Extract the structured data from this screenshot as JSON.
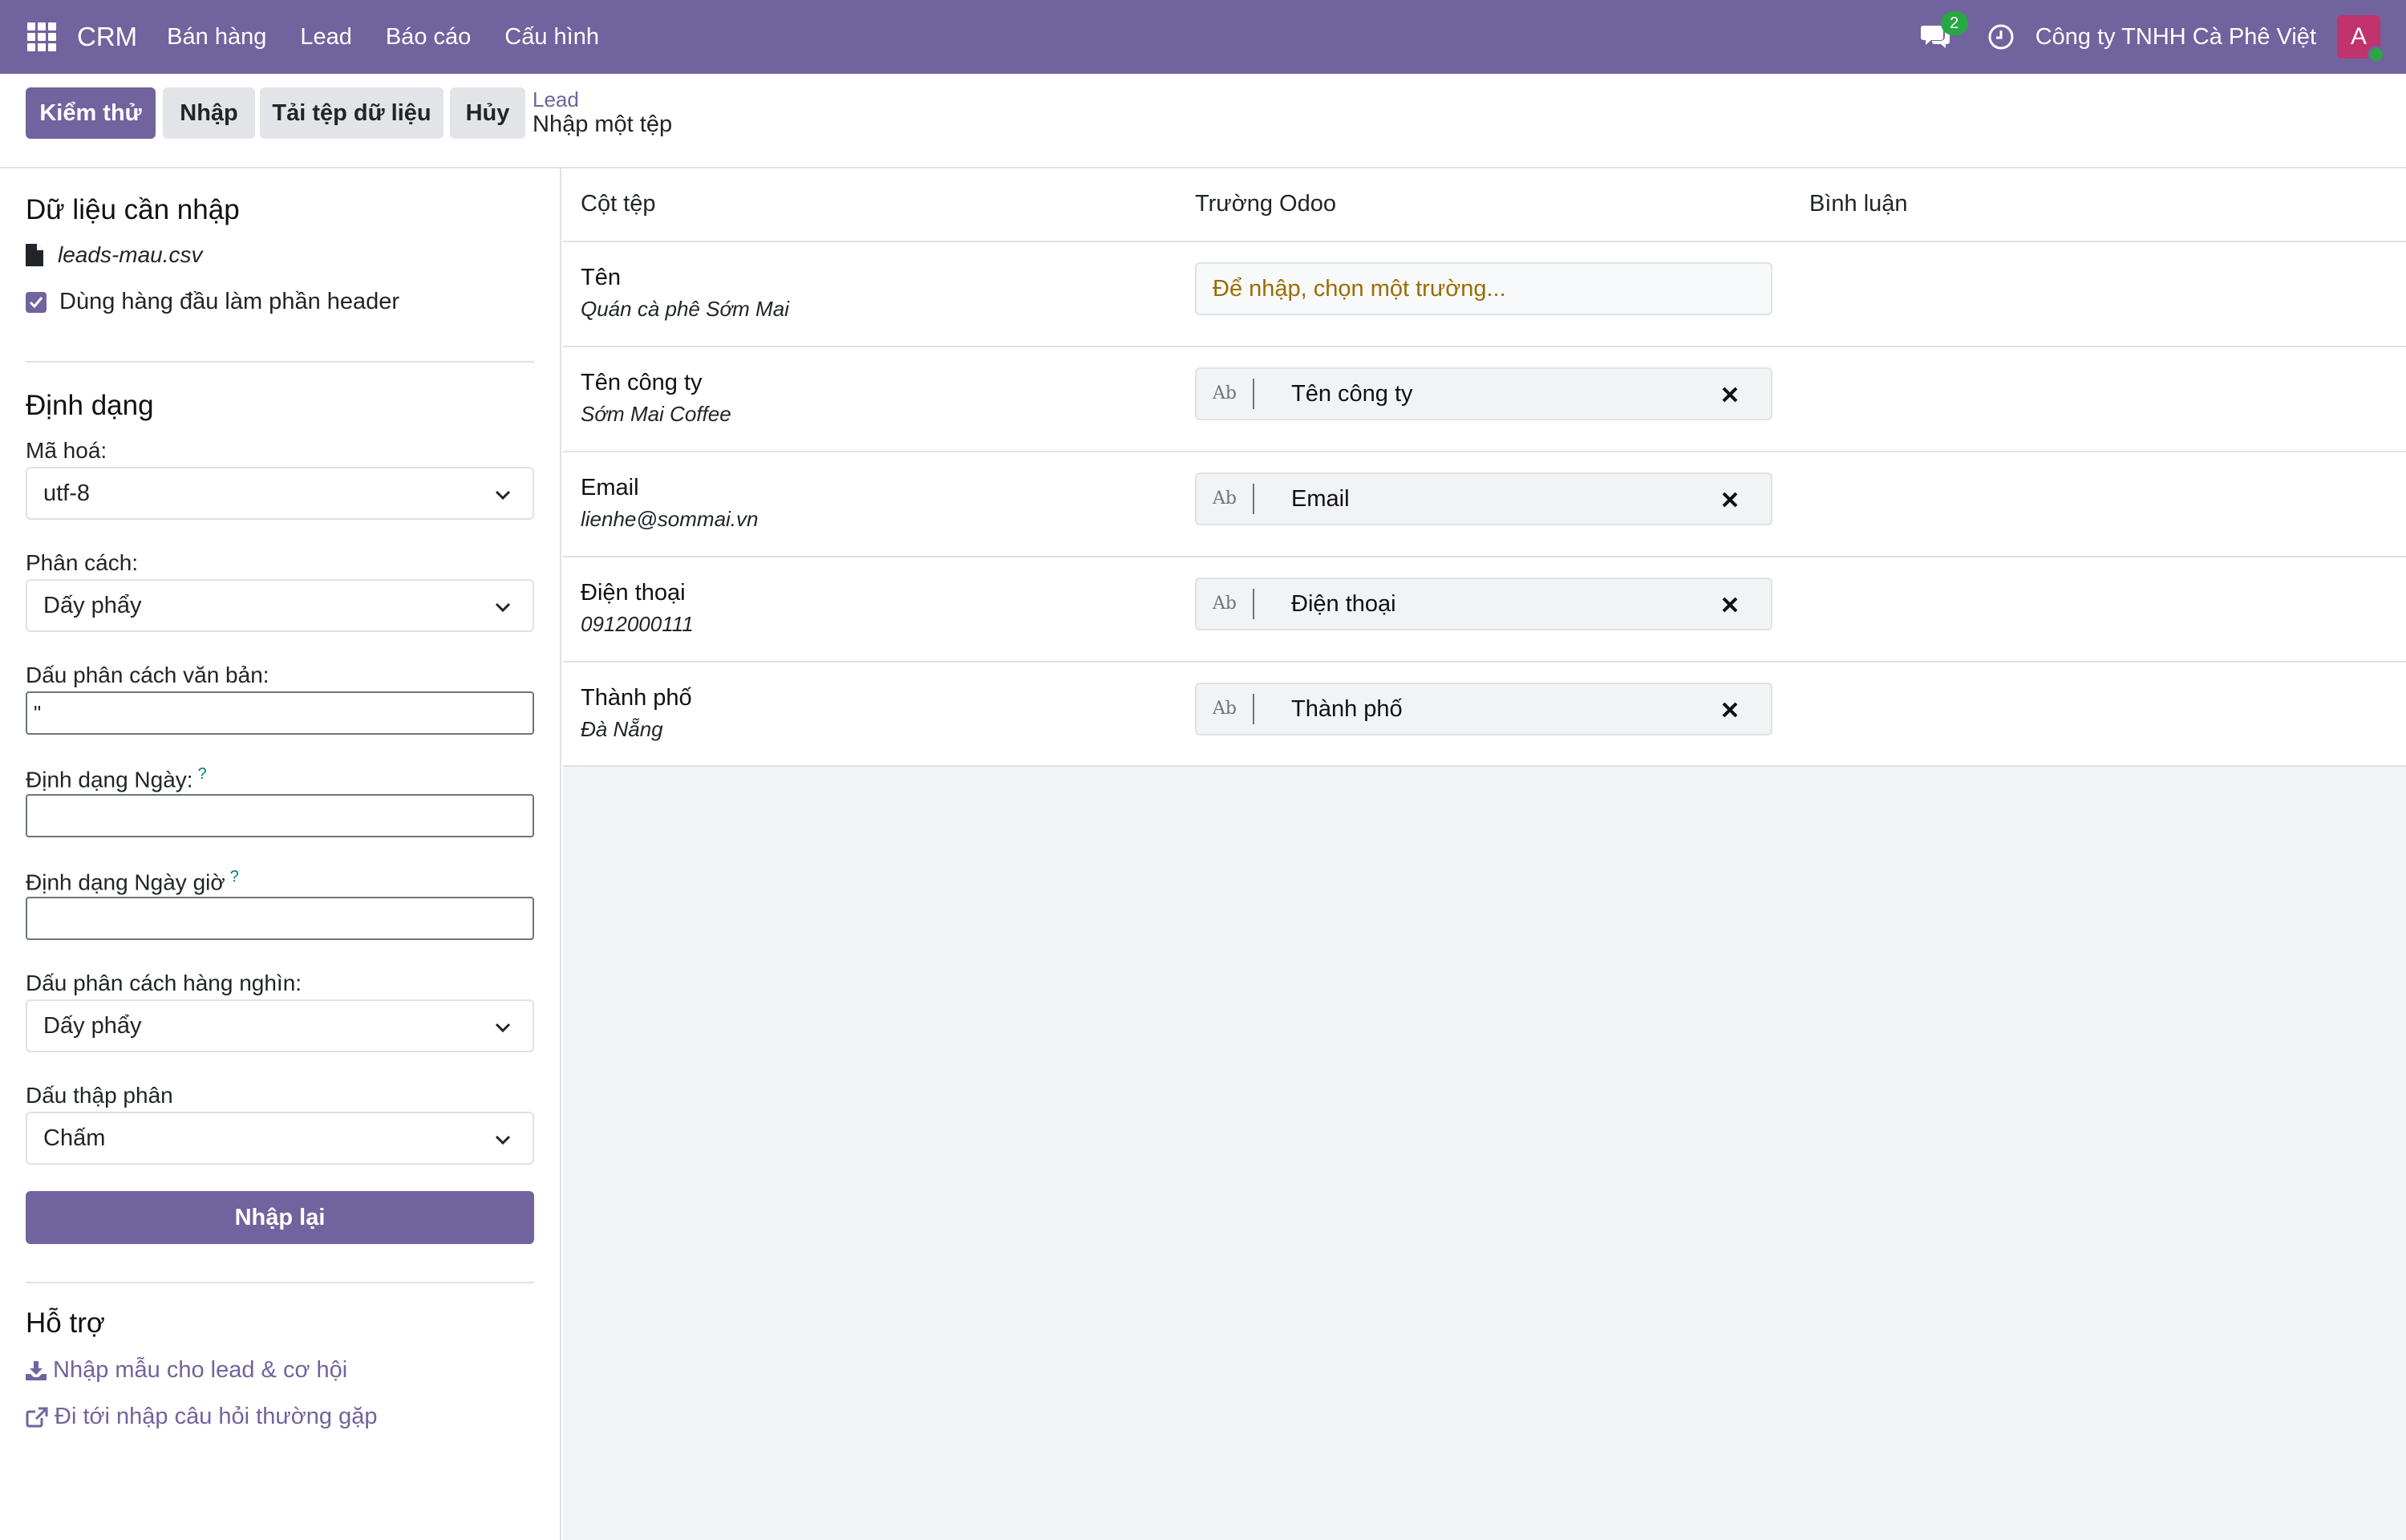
{
  "navbar": {
    "brand": "CRM",
    "menu": [
      "Bán hàng",
      "Lead",
      "Báo cáo",
      "Cấu hình"
    ],
    "chat_count": "2",
    "company": "Công ty TNHH Cà Phê Việt",
    "avatar_letter": "A"
  },
  "control": {
    "buttons": {
      "test": "Kiểm thử",
      "import": "Nhập",
      "load_file": "Tải tệp dữ liệu",
      "cancel": "Hủy"
    },
    "breadcrumb_parent": "Lead",
    "breadcrumb_current": "Nhập một tệp"
  },
  "sidebar": {
    "data_heading": "Dữ liệu cần nhập",
    "file_name": "leads-mau.csv",
    "header_checkbox_label": "Dùng hàng đầu làm phần header",
    "header_checked": true,
    "format_heading": "Định dạng",
    "encoding_label": "Mã hoá:",
    "encoding_value": "utf-8",
    "separator_label": "Phân cách:",
    "separator_value": "Dấy phẩy",
    "text_delimiter_label": "Dấu phân cách văn bản:",
    "text_delimiter_value": "\"",
    "date_format_label": "Định dạng Ngày:",
    "date_format_value": "",
    "datetime_format_label": "Định dạng Ngày giờ",
    "datetime_format_value": "",
    "help_mark": "?",
    "thousands_label": "Dấu phân cách hàng nghìn:",
    "thousands_value": "Dấy phẩy",
    "decimal_label": "Dấu thập phân",
    "decimal_value": "Chấm",
    "reimport_button": "Nhập lại",
    "help_heading": "Hỗ trợ",
    "template_link": "Nhập mẫu cho lead & cơ hội",
    "faq_link": "Đi tới nhập câu hỏi thường gặp"
  },
  "table": {
    "headers": {
      "file_column": "Cột tệp",
      "odoo_field": "Trường Odoo",
      "comments": "Bình luận"
    },
    "field_type_badge": "Ab",
    "unmapped_placeholder": "Để nhập, chọn một trường...",
    "rows": [
      {
        "column": "Tên",
        "sample": "Quán cà phê Sớm Mai",
        "field": ""
      },
      {
        "column": "Tên công ty",
        "sample": "Sớm Mai Coffee",
        "field": "Tên công ty"
      },
      {
        "column": "Email",
        "sample": "lienhe@sommai.vn",
        "field": "Email"
      },
      {
        "column": "Điện thoại",
        "sample": "0912000111",
        "field": "Điện thoại"
      },
      {
        "column": "Thành phố",
        "sample": "Đà Nẵng",
        "field": "Thành phố"
      }
    ]
  },
  "colors": {
    "brand": "#71639e",
    "placeholder": "#9a6d00",
    "success": "#28a745",
    "avatar": "#c0336c"
  }
}
